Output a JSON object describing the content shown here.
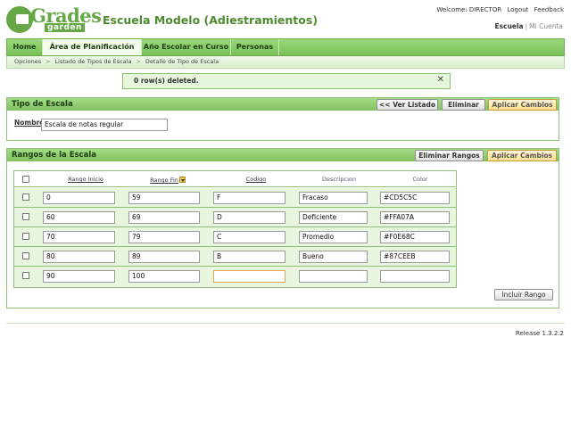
{
  "logo": {
    "word": "Grades",
    "sub": "garden"
  },
  "school_title": "Escuela Modelo (Adiestramientos)",
  "top_links": {
    "welcome": "Welcome: DIRECTOR",
    "logout": "Logout",
    "feedback": "Feedback"
  },
  "account_links": {
    "school": "Escuela",
    "sep": "|",
    "my_account": "Mi Cuenta"
  },
  "nav": {
    "tabs": [
      {
        "label": "Home"
      },
      {
        "label": "Área de Planificación"
      },
      {
        "label": "Año Escolar en Curso"
      },
      {
        "label": "Personas"
      }
    ],
    "selected": "Área de Planificación"
  },
  "breadcrumb": {
    "items": [
      "Opciones",
      "Listado de Tipos de Escala",
      "Detalle de Tipo de Escala"
    ],
    "sep": ">"
  },
  "message": {
    "text": "0 row(s) deleted.",
    "close": "✕"
  },
  "tipo_panel": {
    "title": "Tipo de Escala",
    "buttons": {
      "back": "<< Ver Listado",
      "delete": "Eliminar",
      "apply": "Aplicar Cambios"
    },
    "field_label": "Nombre",
    "field_value": "Escala de notas regular"
  },
  "rangos_panel": {
    "title": "Rangos de la Escala",
    "buttons": {
      "delete_ranges": "Eliminar Rangos",
      "apply": "Aplicar Cambios",
      "include": "Incluir Rango"
    },
    "columns": [
      "Rango Inicio",
      "Rango Fin",
      "Codigo",
      "Descripcion",
      "Color"
    ],
    "rows": [
      {
        "start": "0",
        "end": "59",
        "code": "F",
        "desc": "Fracaso",
        "color": "#CD5C5C"
      },
      {
        "start": "60",
        "end": "69",
        "code": "D",
        "desc": "Deficiente",
        "color": "#FFA07A"
      },
      {
        "start": "70",
        "end": "79",
        "code": "C",
        "desc": "Promedio",
        "color": "#F0E68C"
      },
      {
        "start": "80",
        "end": "89",
        "code": "B",
        "desc": "Bueno",
        "color": "#87CEEB"
      },
      {
        "start": "90",
        "end": "100",
        "code": "",
        "desc": "",
        "color": ""
      }
    ]
  },
  "footer": {
    "release": "Release 1.3.2.2"
  },
  "colors": {
    "brand_green": "#66a846",
    "title_green": "#4f8a2f",
    "row_bg": "#e8f5df",
    "accent_button": "#ffdf8c"
  }
}
